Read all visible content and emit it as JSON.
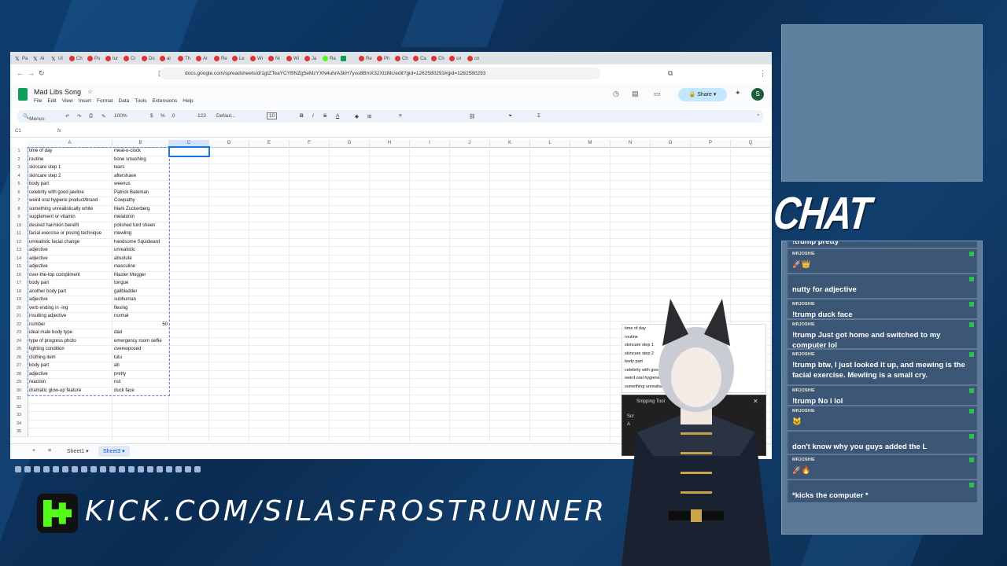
{
  "browser": {
    "tabs": [
      {
        "icon": "x-icon",
        "label": "Pa"
      },
      {
        "icon": "x-icon",
        "label": "Ai"
      },
      {
        "icon": "x-icon",
        "label": "Ul"
      },
      {
        "icon": "youtube-icon",
        "label": "Ch"
      },
      {
        "icon": "youtube-icon",
        "label": "Po"
      },
      {
        "icon": "youtube-icon",
        "label": "tur"
      },
      {
        "icon": "youtube-icon",
        "label": "Cr"
      },
      {
        "icon": "youtube-icon",
        "label": "Do"
      },
      {
        "icon": "youtube-icon",
        "label": "al"
      },
      {
        "icon": "youtube-icon",
        "label": "Th"
      },
      {
        "icon": "youtube-icon",
        "label": "Ar"
      },
      {
        "icon": "youtube-icon",
        "label": "Re"
      },
      {
        "icon": "youtube-icon",
        "label": "Le"
      },
      {
        "icon": "youtube-icon",
        "label": "Wi"
      },
      {
        "icon": "youtube-icon",
        "label": "Ni"
      },
      {
        "icon": "youtube-icon",
        "label": "Wi"
      },
      {
        "icon": "youtube-icon",
        "label": "Ja"
      },
      {
        "icon": "kick-icon",
        "label": "Ra"
      },
      {
        "icon": "sheets-icon",
        "label": ""
      },
      {
        "icon": "circle-icon",
        "label": "Re"
      },
      {
        "icon": "circle-icon",
        "label": "Ph"
      },
      {
        "icon": "circle-icon",
        "label": "Ch"
      },
      {
        "icon": "circle-icon",
        "label": "Ca"
      },
      {
        "icon": "circle-icon",
        "label": "Ch"
      },
      {
        "icon": "circle-icon",
        "label": "cn"
      },
      {
        "icon": "circle-icon",
        "label": "cn"
      }
    ],
    "url": "docs.google.com/spreadsheets/d/1gIZTeaYCYBNZg5eMzYXN4uhrA3kH7yvo8BmX32XtzMc/edit?gid=1262580293#gid=1262580293"
  },
  "sheets": {
    "title": "Mad Libs Song",
    "menu": [
      "File",
      "Edit",
      "View",
      "Insert",
      "Format",
      "Data",
      "Tools",
      "Extensions",
      "Help"
    ],
    "share_label": "Share",
    "avatar_letter": "S",
    "toolbar": {
      "search": "Menus",
      "zoom": "100%",
      "percent": "%",
      "decimals": ".0",
      "currency_more": "123",
      "font": "Defaul...",
      "font_size": "10"
    },
    "name_box": "C1",
    "fx": "fx",
    "columns": [
      "A",
      "B",
      "C",
      "D",
      "E",
      "F",
      "G",
      "H",
      "I",
      "J",
      "K",
      "L",
      "M",
      "N",
      "O",
      "P",
      "Q"
    ],
    "rows": [
      [
        "time of day",
        "meal-o-clock"
      ],
      [
        "routine",
        "bone smashing"
      ],
      [
        "skincare step 1",
        "tears"
      ],
      [
        "skincare step 2",
        "aftershave"
      ],
      [
        "body part",
        "weenus"
      ],
      [
        "celebrity with good jawline",
        "Patrick Bateman"
      ],
      [
        "weird oral hygiene product/brand",
        "Cowpathy"
      ],
      [
        "something unrealistically white",
        "Mark Zuckerberg"
      ],
      [
        "supplement or vitamin",
        "melatonin"
      ],
      [
        "desired hair/skin benefit",
        "polished turd sheen"
      ],
      [
        "facial exercise or posing technique",
        "mewling"
      ],
      [
        "unrealistic facial change",
        "handsome Squidward"
      ],
      [
        "adjective",
        "unrealistic"
      ],
      [
        "adjective",
        "absolute"
      ],
      [
        "adjective",
        "masculine"
      ],
      [
        "over-the-top compliment",
        "Master Mogger"
      ],
      [
        "body part",
        "tongue"
      ],
      [
        "another body part",
        "gallbladder"
      ],
      [
        "adjective",
        "subhuman"
      ],
      [
        "verb ending in -ing",
        "flexing"
      ],
      [
        "insulting adjective",
        "normal"
      ],
      [
        "number",
        "50"
      ],
      [
        "ideal male body type",
        "dad"
      ],
      [
        "type of progress photo",
        "emergency room selfie"
      ],
      [
        "lighting condition",
        "overexposed"
      ],
      [
        "clothing item",
        "tutu"
      ],
      [
        "body part",
        "ab"
      ],
      [
        "adjective",
        "pretty"
      ],
      [
        "reaction",
        "nut"
      ],
      [
        "dramatic glow-up feature",
        "duck face"
      ],
      [
        "",
        ""
      ],
      [
        "",
        ""
      ],
      [
        "",
        ""
      ],
      [
        "",
        ""
      ],
      [
        "",
        ""
      ]
    ],
    "sheet_tabs": [
      "Sheet1",
      "Sheet3"
    ]
  },
  "overlay": {
    "chat_title": "CHAT",
    "kick_url": "KICK.COM/SILASFROSTRUNNER",
    "chat_messages": [
      {
        "user": "",
        "text": "!trump pretty"
      },
      {
        "user": "MRJOSHIE",
        "text": "🚀👑"
      },
      {
        "user": "",
        "text": "nutty for adjective"
      },
      {
        "user": "MRJOSHIE",
        "text": "!trump duck face"
      },
      {
        "user": "MRJOSHIE",
        "text": "!trump Just got home and switched to my computer lol"
      },
      {
        "user": "MRJOSHIE",
        "text": "!trump btw, I just looked it up, and mewing is the facial exercise. Mewling is a small cry."
      },
      {
        "user": "MRJOSHIE",
        "text": "!trump No I lol"
      },
      {
        "user": "MRJOSHIE",
        "text": "🐱"
      },
      {
        "user": "",
        "text": "don't know why you guys added the L"
      },
      {
        "user": "MRJOSHIE",
        "text": "🚀🔥"
      },
      {
        "user": "",
        "text": "*kicks the computer *"
      }
    ],
    "snipping_tool": "Snipping Tool",
    "snip_body_1": "Scr",
    "snip_body_2": "A"
  }
}
